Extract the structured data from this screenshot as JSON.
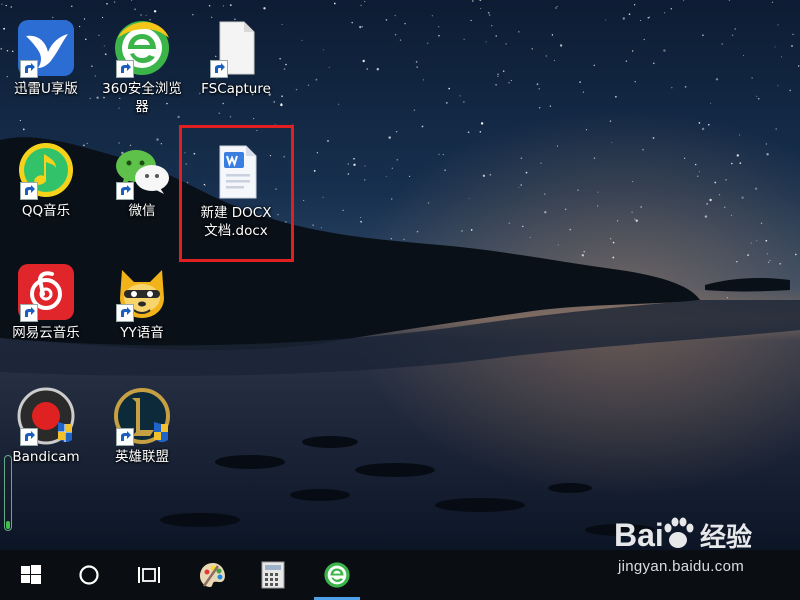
{
  "desktop": {
    "icons": [
      {
        "label": "迅雷U享版",
        "icon": "thunder-bird-icon"
      },
      {
        "label": "360安全浏览\n器",
        "icon": "360-browser-icon"
      },
      {
        "label": "FSCapture",
        "icon": "blank-document-icon"
      },
      {
        "label": "QQ音乐",
        "icon": "qq-music-icon"
      },
      {
        "label": "微信",
        "icon": "wechat-icon"
      },
      {
        "label": "新建 DOCX\n文档.docx",
        "icon": "wps-word-document-icon"
      },
      {
        "label": "网易云音乐",
        "icon": "netease-music-icon"
      },
      {
        "label": "YY语音",
        "icon": "yy-voice-icon"
      },
      {
        "label": "Bandicam",
        "icon": "bandicam-icon"
      },
      {
        "label": "英雄联盟",
        "icon": "league-of-legends-icon"
      }
    ],
    "selected_item": "新建 DOCX\n文档.docx",
    "highlight_color": "#e02020"
  },
  "taskbar": {
    "items": [
      {
        "icon": "windows-start-icon"
      },
      {
        "icon": "cortana-circle-icon"
      },
      {
        "icon": "task-view-icon"
      },
      {
        "icon": "paint-palette-icon"
      },
      {
        "icon": "calculator-icon"
      },
      {
        "icon": "360-browser-icon",
        "active": true
      }
    ],
    "accent": "#4ea0e8"
  },
  "watermark": {
    "logo_text": "Bai 经验",
    "site": "jingyan.baidu.com"
  }
}
